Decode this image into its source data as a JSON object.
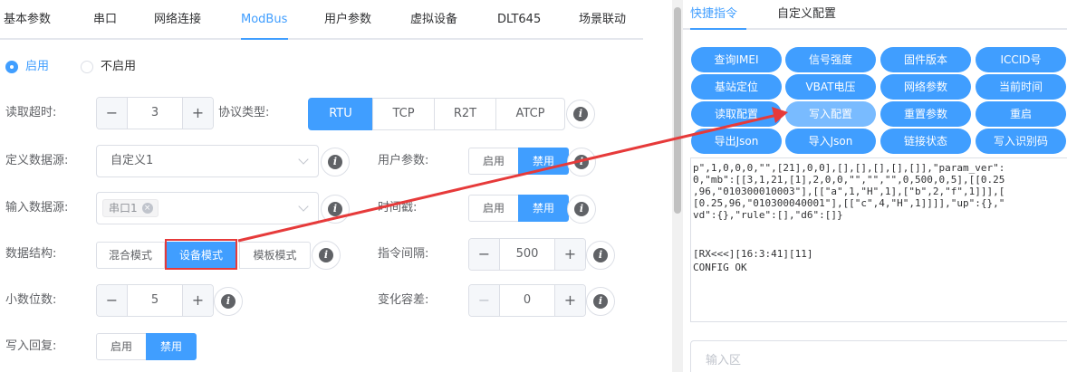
{
  "tabs": [
    "基本参数",
    "串口",
    "网络连接",
    "ModBus",
    "用户参数",
    "虚拟设备",
    "DLT645",
    "场景联动"
  ],
  "enable": {
    "options": [
      "启用",
      "不启用"
    ],
    "selected": 0
  },
  "form": {
    "read_timeout_label": "读取超时:",
    "read_timeout_value": "3",
    "protocol_label": "协议类型:",
    "protocol_options": [
      "RTU",
      "TCP",
      "R2T",
      "ATCP"
    ],
    "protocol_selected": "RTU",
    "custom_source_label": "定义数据源:",
    "custom_source_value": "自定义1",
    "user_param_label": "用户参数:",
    "enable_label": "启用",
    "disable_label": "禁用",
    "input_source_label": "输入数据源:",
    "input_source_tag": "串口1",
    "timestamp_label": "时间戳:",
    "data_struct_label": "数据结构:",
    "data_struct_options": [
      "混合模式",
      "设备模式",
      "模板模式"
    ],
    "data_struct_selected": "设备模式",
    "cmd_interval_label": "指令间隔:",
    "cmd_interval_value": "500",
    "decimal_label": "小数位数:",
    "decimal_value": "5",
    "tolerance_label": "变化容差:",
    "tolerance_value": "0",
    "write_reply_label": "写入回复:",
    "minus": "−",
    "plus": "+",
    "help_glyph": "i",
    "tag_close": "×"
  },
  "right": {
    "tabs": [
      "快捷指令",
      "自定义配置"
    ],
    "commands": [
      "查询IMEI",
      "信号强度",
      "固件版本",
      "ICCID号",
      "基站定位",
      "VBAT电压",
      "网络参数",
      "当前时间",
      "读取配置",
      "写入配置",
      "重置参数",
      "重启",
      "导出Json",
      "导入Json",
      "链接状态",
      "写入识别码"
    ],
    "console_lines": [
      "p\",1,0,0,0,\"\",[21],0,0],[],[],[],[],[]],\"param_ver\":",
      "0,\"mb\":[[3,1,21,[1],2,0,0,\"\",\"\",\"\",0,500,0,5],[[0.25",
      ",96,\"010300010003\"],[[\"a\",1,\"H\",1],[\"b\",2,\"f\",1]]],[",
      "[0.25,96,\"010300040001\"],[[\"c\",4,\"H\",1]]]],\"up\":{},\"",
      "vd\":{},\"rule\":[],\"d6\":[]}",
      "",
      "[RX<<<][16:3:41][11]",
      "CONFIG OK"
    ],
    "input_placeholder": "输入区"
  },
  "colors": {
    "accent": "#409eff",
    "highlight": "#e63a3a"
  }
}
